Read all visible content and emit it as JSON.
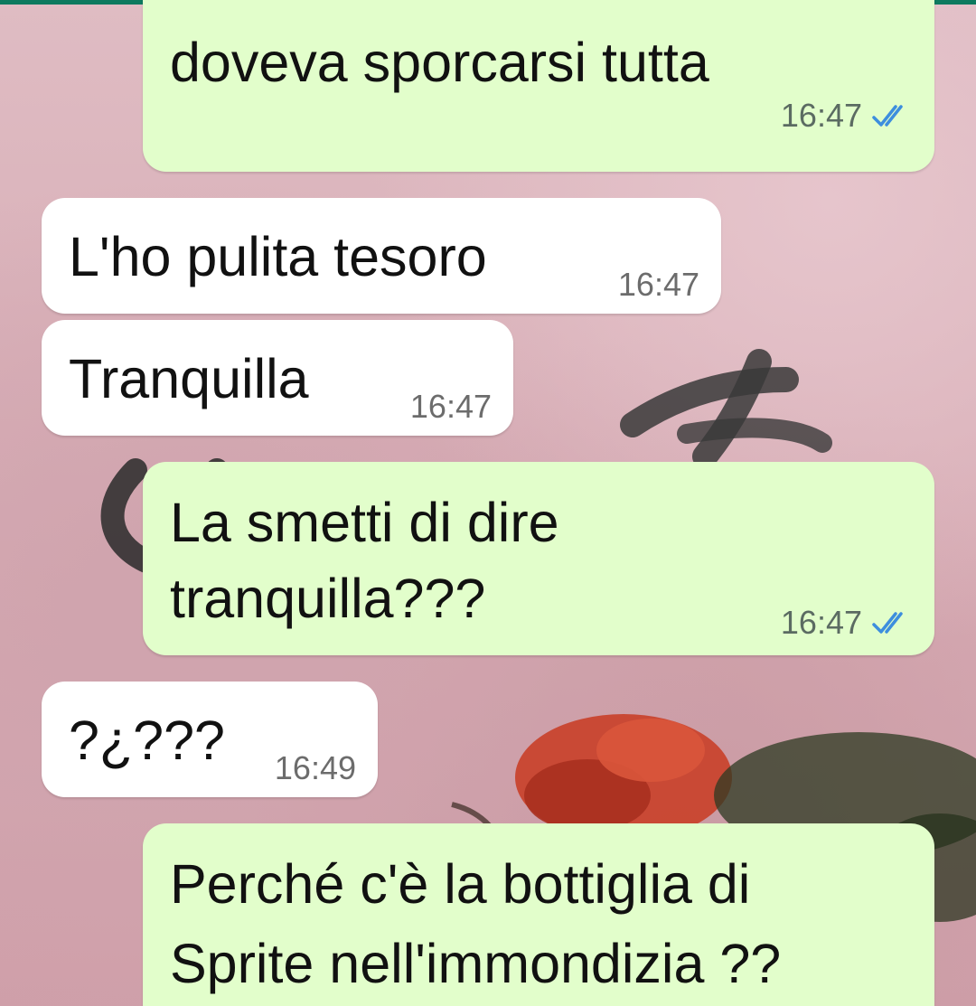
{
  "colors": {
    "outgoing_bubble": "#e2fecb",
    "incoming_bubble": "#ffffff",
    "read_ticks": "#3d8ede",
    "status_bar_accent": "#0d7a5f"
  },
  "messages": [
    {
      "direction": "outgoing",
      "lines": [
        "doveva sporcarsi tutta"
      ],
      "time": "16:47",
      "status_icon": "double-check-read-icon"
    },
    {
      "direction": "incoming",
      "lines": [
        "L'ho pulita tesoro"
      ],
      "time": "16:47"
    },
    {
      "direction": "incoming",
      "lines": [
        "Tranquilla"
      ],
      "time": "16:47"
    },
    {
      "direction": "outgoing",
      "lines": [
        "La smetti di dire",
        "tranquilla???"
      ],
      "time": "16:47",
      "status_icon": "double-check-read-icon"
    },
    {
      "direction": "incoming",
      "lines": [
        "?¿???"
      ],
      "time": "16:49"
    },
    {
      "direction": "outgoing",
      "lines": [
        "Perché c'è la bottiglia di",
        "Sprite nell'immondizia ??"
      ]
    }
  ]
}
